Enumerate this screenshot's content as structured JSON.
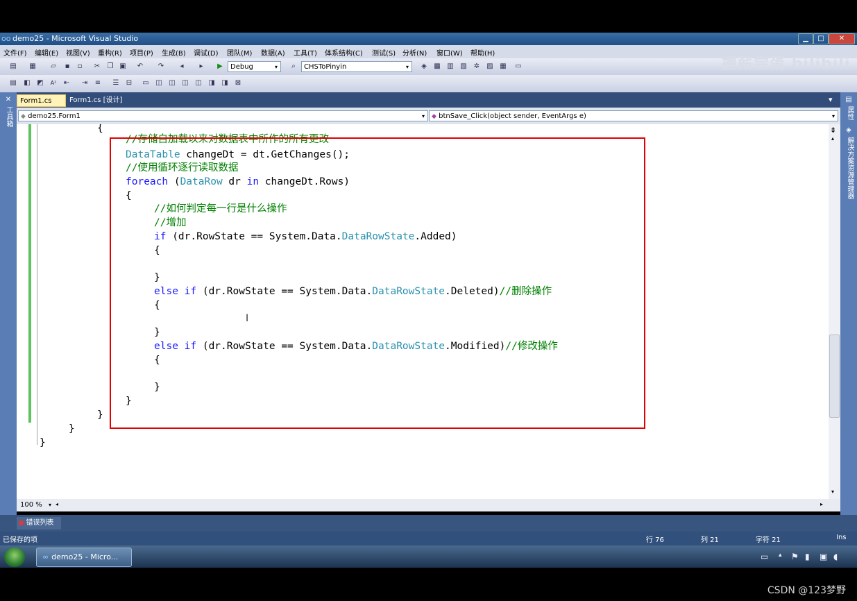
{
  "window": {
    "title": "demo25 - Microsoft Visual Studio",
    "logo": "oo",
    "min": "▁",
    "max": "□",
    "close": "✕"
  },
  "menu": [
    "文件(F)",
    "编辑(E)",
    "视图(V)",
    "重构(R)",
    "项目(P)",
    "生成(B)",
    "调试(D)",
    "团队(M)",
    "数据(A)",
    "工具(T)",
    "体系结构(C)",
    "测试(S)",
    "分析(N)",
    "窗口(W)",
    "帮助(H)"
  ],
  "toolbar": {
    "config": "Debug",
    "target": "CHSToPinyin"
  },
  "watermark": "握薪尝蛋 bilibili",
  "left_panel": {
    "label": "工具箱"
  },
  "right_panel": {
    "label1": "属性",
    "label2": "解决方案资源管理器"
  },
  "tabs": [
    {
      "label": "Form1.cs",
      "close": "✕",
      "active": true
    },
    {
      "label": "Form1.cs [设计]",
      "active": false
    }
  ],
  "tab_dropdown": "▾",
  "nav": {
    "class_selector": "demo25.Form1",
    "member_selector": "btnSave_Click(object sender, EventArgs e)"
  },
  "code": {
    "l0": "{",
    "l1": "//存储自加载以来对数据表中所作的所有更改",
    "l2_type": "DataTable",
    "l2_rest": " changeDt = dt.GetChanges();",
    "l3": "//使用循环逐行读取数据",
    "l4_kw": "foreach",
    "l4_a": " (",
    "l4_type": "DataRow",
    "l4_b": " dr ",
    "l4_in": "in",
    "l4_c": " changeDt.Rows)",
    "l5": "{",
    "l6": "//如何判定每一行是什么操作",
    "l7": "//增加",
    "l8_kw": "if",
    "l8_a": " (dr.RowState == System.Data.",
    "l8_type": "DataRowState",
    "l8_b": ".Added)",
    "l9": "{",
    "l11": "}",
    "l12_kw": "else if",
    "l12_a": " (dr.RowState == System.Data.",
    "l12_type": "DataRowState",
    "l12_b": ".Deleted)",
    "l12_cm": "//删除操作",
    "l13": "{",
    "l15": "}",
    "l16_kw": "else if",
    "l16_a": " (dr.RowState == System.Data.",
    "l16_type": "DataRowState",
    "l16_b": ".Modified)",
    "l16_cm": "//修改操作",
    "l17": "{",
    "l19": "}",
    "l20": "}",
    "l21": "}",
    "l22": "}",
    "l23": "}"
  },
  "zoom": "100 %",
  "error_list": "错误列表",
  "status": {
    "message": "已保存的项",
    "line": "行 76",
    "col": "列 21",
    "char": "字符 21",
    "mode": "Ins"
  },
  "taskbar": {
    "item": "demo25 - Micro..."
  },
  "csdn": "CSDN @123梦野"
}
